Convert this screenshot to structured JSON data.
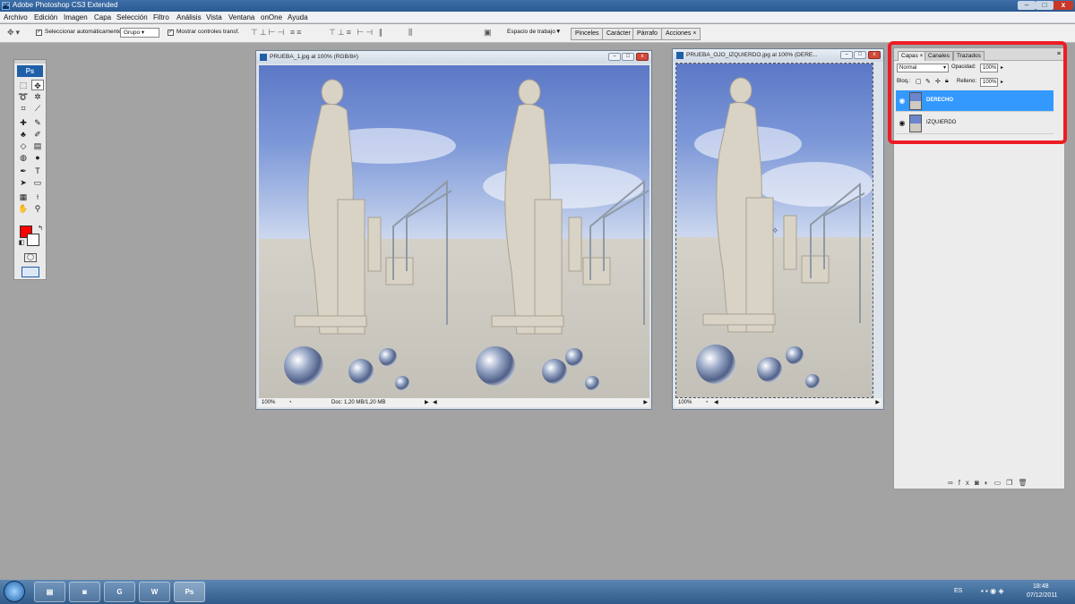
{
  "app": {
    "title": "Adobe Photoshop CS3 Extended",
    "logo": "Ps",
    "window_buttons": {
      "minimize": "–",
      "maximize": "□",
      "close": "x"
    }
  },
  "menu": [
    "Archivo",
    "Edición",
    "Imagen",
    "Capa",
    "Selección",
    "Filtro",
    "Análisis",
    "Vista",
    "Ventana",
    "onOne",
    "Ayuda"
  ],
  "options": {
    "auto_select_label": "Seleccionar automáticamente:",
    "auto_select_value": "Grupo",
    "show_controls_label": "Mostrar controles transf.",
    "workspace_label": "Espacio de trabajo",
    "dock_tabs": [
      "Pinceles",
      "Carácter",
      "Párrafo",
      "Acciones"
    ]
  },
  "doc1": {
    "title": "PRUEBA_1.jpg al 100% (RGB/8#)",
    "zoom": "100%",
    "doc_info": "Doc: 1,20 MB/1,20 MB"
  },
  "doc2": {
    "title": "PRUEBA_OJO_IZQUIERDO.jpg al 100% (DERE...",
    "zoom": "100%"
  },
  "layers_panel": {
    "tabs": [
      "Capas",
      "Canales",
      "Trazados"
    ],
    "blend_mode": "Normal",
    "opacity_label": "Opacidad:",
    "opacity_value": "100%",
    "lock_label": "Bloq.:",
    "fill_label": "Relleno:",
    "fill_value": "100%",
    "layers": [
      {
        "name": "DERECHO",
        "active": true
      },
      {
        "name": "IZQUIERDO",
        "active": false
      }
    ],
    "highlight_color": "#ee1c25",
    "selection_color": "#3399ff"
  },
  "tray": {
    "language": "ES",
    "time": "18:48",
    "date": "07/12/2011"
  },
  "taskbar_items": [
    "explorer-icon",
    "media-icon",
    "camtasia-icon",
    "word-icon",
    "photoshop-icon"
  ],
  "colors": {
    "foreground": "#ff0000",
    "background": "#ffffff"
  }
}
